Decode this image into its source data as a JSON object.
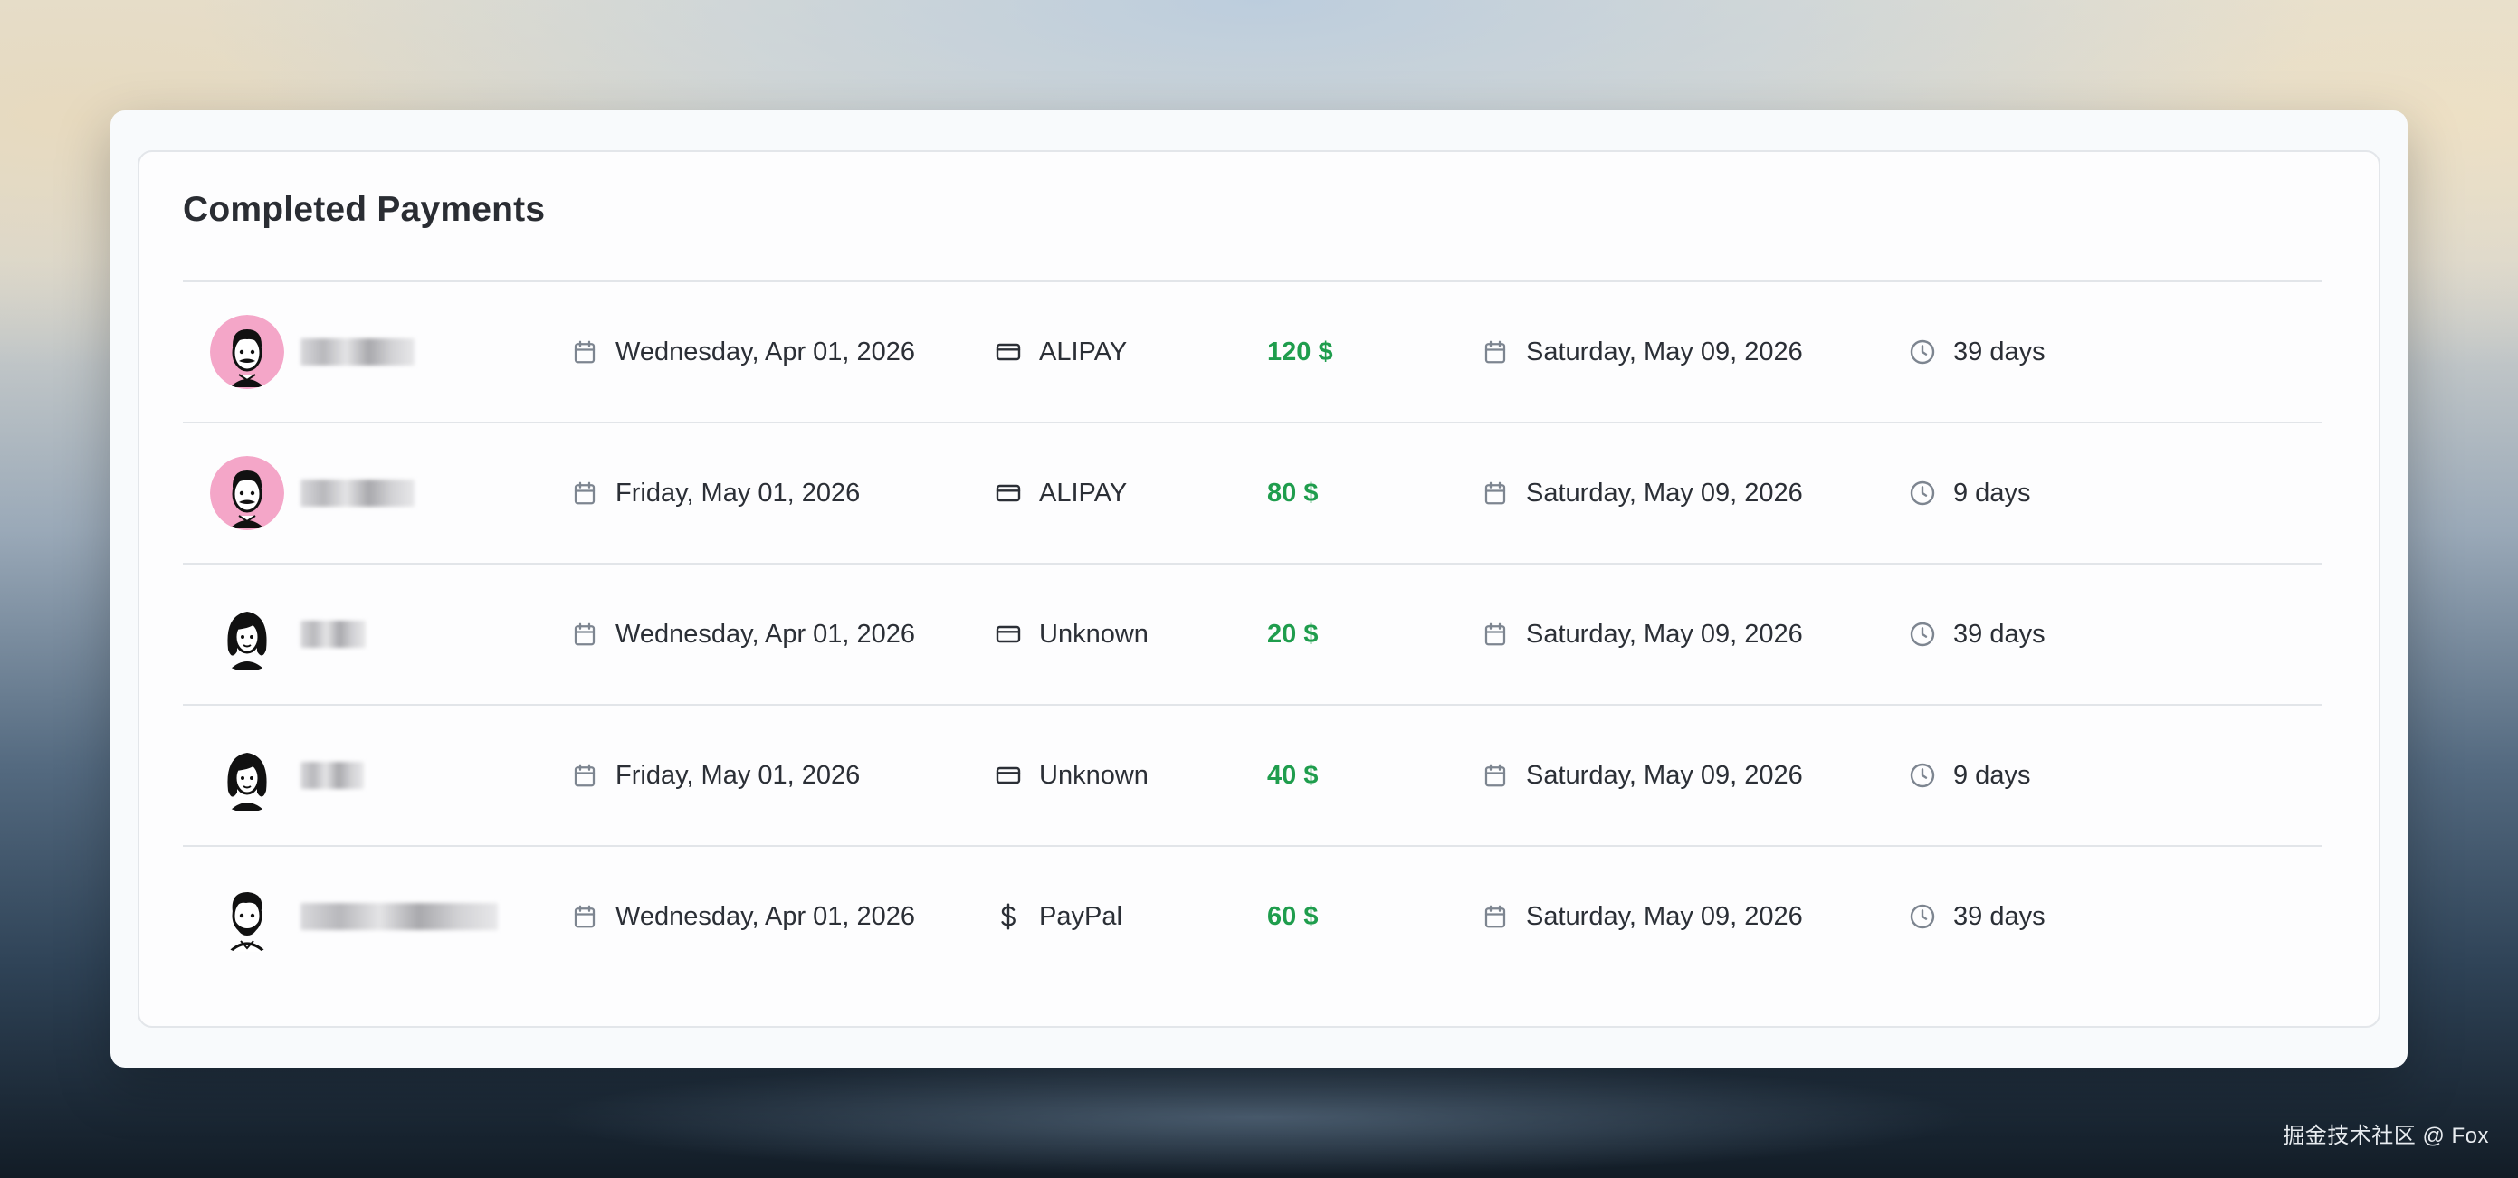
{
  "page": {
    "title": "Completed Payments",
    "footer": "掘金技术社区 @ Fox"
  },
  "colors": {
    "amount": "#1f9d4d",
    "icon": "#7d8590",
    "text": "#2b2f36",
    "avatar_pink": "#f4a6c8"
  },
  "payments": [
    {
      "avatar": "man-mustache-pink",
      "created_icon": "calendar-icon",
      "created": "Wednesday, Apr 01, 2026",
      "method_icon": "credit-card-icon",
      "method": "ALIPAY",
      "amount": "120 $",
      "due_icon": "calendar-icon",
      "due": "Saturday, May 09, 2026",
      "remain_icon": "clock-icon",
      "remaining": "39 days"
    },
    {
      "avatar": "man-mustache-pink",
      "created_icon": "calendar-icon",
      "created": "Friday, May 01, 2026",
      "method_icon": "credit-card-icon",
      "method": "ALIPAY",
      "amount": "80 $",
      "due_icon": "calendar-icon",
      "due": "Saturday, May 09, 2026",
      "remain_icon": "clock-icon",
      "remaining": "9 days"
    },
    {
      "avatar": "woman-dark-hair",
      "created_icon": "calendar-icon",
      "created": "Wednesday, Apr 01, 2026",
      "method_icon": "credit-card-icon",
      "method": "Unknown",
      "amount": "20 $",
      "due_icon": "calendar-icon",
      "due": "Saturday, May 09, 2026",
      "remain_icon": "clock-icon",
      "remaining": "39 days"
    },
    {
      "avatar": "woman-dark-hair",
      "created_icon": "calendar-icon",
      "created": "Friday, May 01, 2026",
      "method_icon": "credit-card-icon",
      "method": "Unknown",
      "amount": "40 $",
      "due_icon": "calendar-icon",
      "due": "Saturday, May 09, 2026",
      "remain_icon": "clock-icon",
      "remaining": "9 days"
    },
    {
      "avatar": "man-beard",
      "created_icon": "calendar-icon",
      "created": "Wednesday, Apr 01, 2026",
      "method_icon": "dollar-sign-icon",
      "method": "PayPal",
      "amount": "60 $",
      "due_icon": "calendar-icon",
      "due": "Saturday, May 09, 2026",
      "remain_icon": "clock-icon",
      "remaining": "39 days"
    }
  ]
}
